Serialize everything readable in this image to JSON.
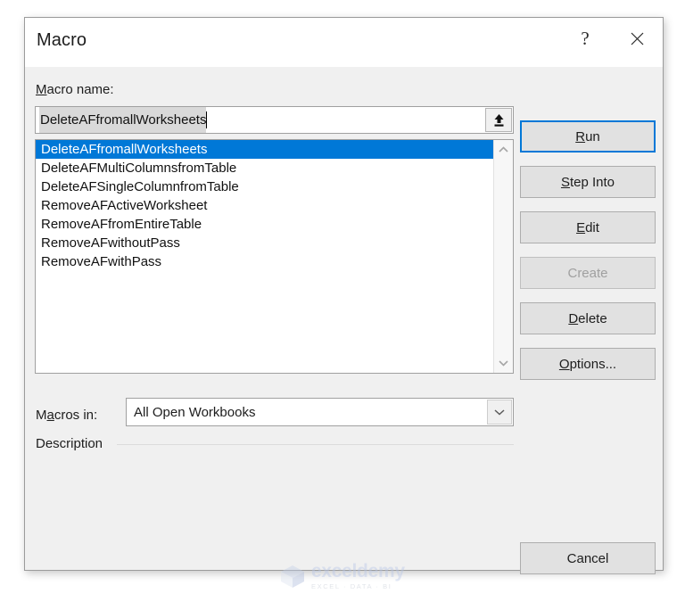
{
  "dialog": {
    "title": "Macro",
    "help_icon": "question-mark-icon",
    "close_icon": "close-icon"
  },
  "macro_name": {
    "label_prefix": "",
    "label_accel": "M",
    "label_suffix": "acro name:",
    "value": "DeleteAFfromallWorksheets",
    "placeholder": "",
    "upload_icon": "upload-arrow-icon"
  },
  "list": {
    "selected_index": 0,
    "items": [
      "DeleteAFfromallWorksheets",
      "DeleteAFMultiColumnsfromTable",
      "DeleteAFSingleColumnfromTable",
      "RemoveAFActiveWorksheet",
      "RemoveAFfromEntireTable",
      "RemoveAFwithoutPass",
      "RemoveAFwithPass"
    ],
    "scroll_up_icon": "chevron-up-icon",
    "scroll_down_icon": "chevron-down-icon"
  },
  "macros_in": {
    "label_prefix": "M",
    "label_accel": "a",
    "label_suffix": "cros in:",
    "value": "All Open Workbooks",
    "options": [
      "All Open Workbooks"
    ],
    "dropdown_icon": "chevron-down-icon"
  },
  "description": {
    "label": "Description"
  },
  "buttons": {
    "run": {
      "accel": "R",
      "rest": "un"
    },
    "step_into": {
      "accel": "S",
      "rest": "tep Into"
    },
    "edit": {
      "accel": "E",
      "rest": "dit"
    },
    "create": {
      "label": "Create"
    },
    "delete": {
      "accel": "D",
      "rest": "elete"
    },
    "options": {
      "accel": "O",
      "rest": "ptions..."
    },
    "cancel": {
      "label": "Cancel"
    }
  },
  "watermark": {
    "name": "exceldemy",
    "tagline": "EXCEL · DATA · BI",
    "logo_icon": "cube-logo-icon"
  },
  "colors": {
    "accent": "#0078d7",
    "selection_text": "#ffffff",
    "dialog_bg": "#f0f0f0",
    "button_bg": "#e1e1e1",
    "disabled_text": "#a0a0a0"
  }
}
